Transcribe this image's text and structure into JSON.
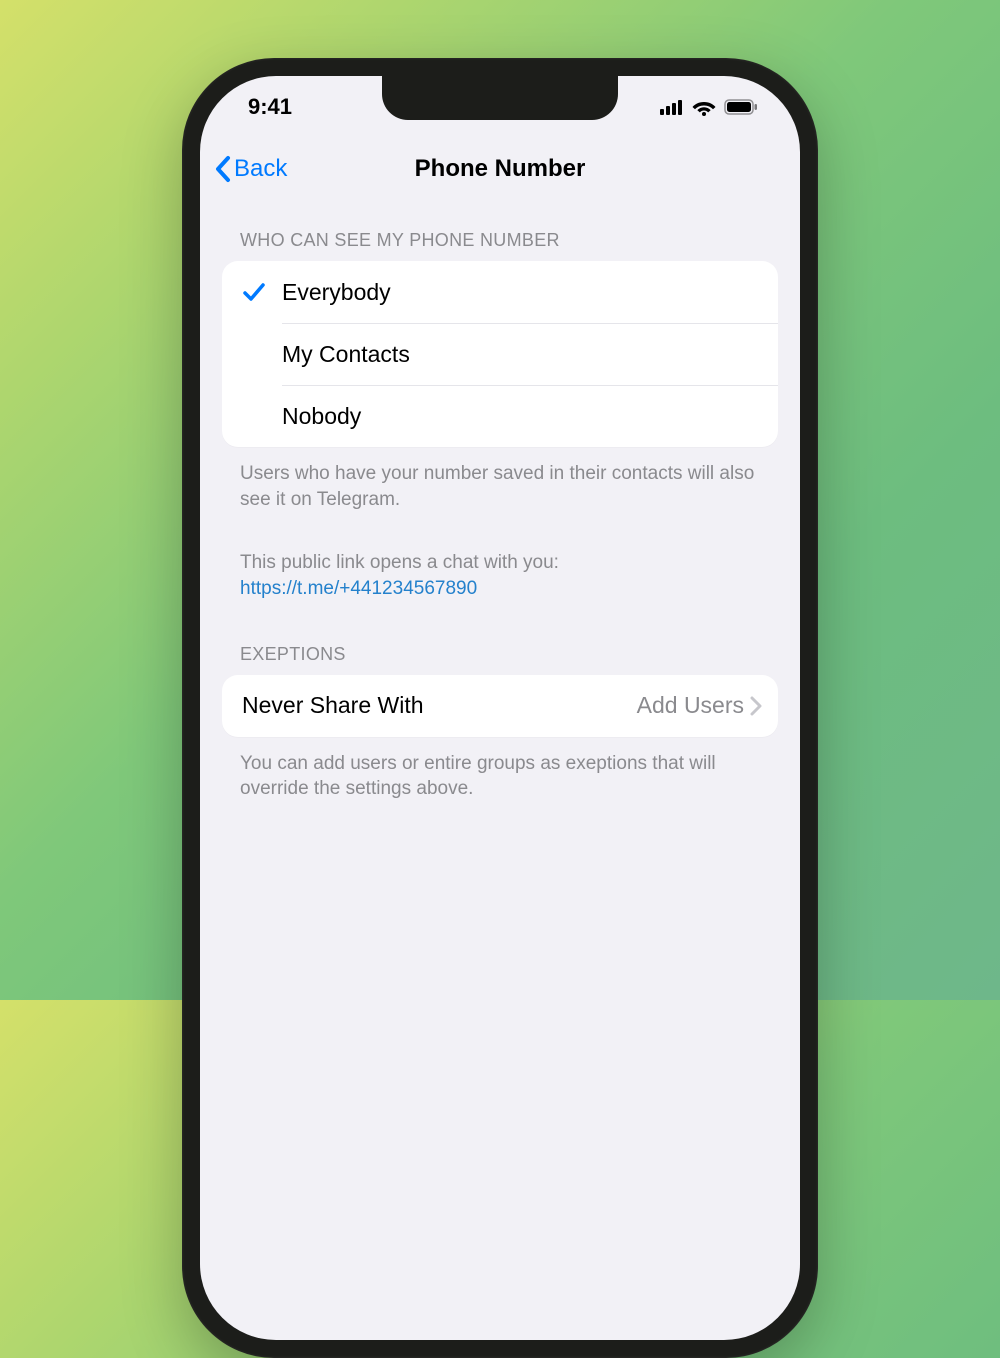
{
  "status": {
    "time": "9:41"
  },
  "nav": {
    "back": "Back",
    "title": "Phone Number"
  },
  "visibility": {
    "header": "WHO CAN SEE MY PHONE NUMBER",
    "options": [
      {
        "label": "Everybody",
        "selected": true
      },
      {
        "label": "My Contacts",
        "selected": false
      },
      {
        "label": "Nobody",
        "selected": false
      }
    ],
    "footer1": "Users who have your number saved in their contacts will also see it on Telegram.",
    "footer2": "This public link opens a chat with you:",
    "link": "https://t.me/+441234567890"
  },
  "exceptions": {
    "header": "EXEPTIONS",
    "row_label": "Never Share With",
    "row_value": "Add Users",
    "footer": "You can add users or entire groups as exeptions that will override the settings above."
  }
}
